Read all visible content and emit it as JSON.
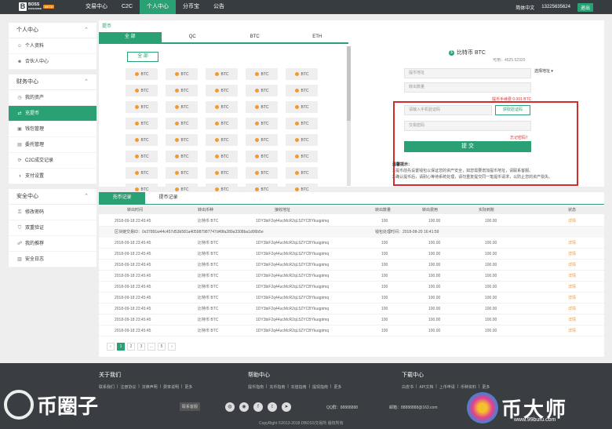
{
  "header": {
    "logo_mark": "B",
    "logo_text": "BOSS",
    "logo_sub": "EXCHANGE",
    "logo_badge": "BETA",
    "nav": [
      "交易中心",
      "C2C",
      "个人中心",
      "分币宝",
      "公告"
    ],
    "active_nav": "个人中心",
    "language": "简体中文",
    "phone": "13225635624",
    "logout": "退出"
  },
  "sidebar": {
    "groups": [
      {
        "title": "个人中心",
        "items": [
          "个人资料",
          "合伙人中心"
        ]
      },
      {
        "title": "财务中心",
        "items": [
          "我的资产",
          "充提币",
          "钱包管理",
          "委托管理",
          "C2C成交记录",
          "支付设置"
        ]
      },
      {
        "title": "安全中心",
        "items": [
          "修改密码",
          "双重验证",
          "我的推荐",
          "安全日志"
        ]
      }
    ],
    "active_item": "充提币",
    "icons": [
      "user-icon",
      "partner-icon",
      "asset-icon",
      "withdraw-icon",
      "wallet-icon",
      "order-icon",
      "c2c-icon",
      "pay-icon",
      "key-icon",
      "shield-icon",
      "referral-icon",
      "log-icon"
    ]
  },
  "withdraw": {
    "breadcrumb": "提币",
    "coin_tabs": [
      "全 部",
      "QC",
      "BTC",
      "ETH"
    ],
    "active_tab": "全 部",
    "all_button": "全 部",
    "coins": [
      "BTC",
      "BTC",
      "BTC",
      "BTC",
      "BTC",
      "BTC",
      "BTC",
      "BTC",
      "BTC",
      "BTC",
      "BTC",
      "BTC",
      "BTC",
      "BTC",
      "BTC",
      "BTC",
      "BTC",
      "BTC",
      "BTC",
      "BTC",
      "BTC",
      "BTC",
      "BTC",
      "BTC",
      "BTC",
      "BTC",
      "BTC",
      "BTC",
      "BTC",
      "BTC",
      "BTC",
      "BTC",
      "BTC",
      "BTC",
      "BTC",
      "BTC",
      "BTC",
      "BTC",
      "BTC",
      "BTC"
    ],
    "coin_title": "比特币 BTC",
    "available": "可用：4525.52320",
    "address_placeholder": "提币地址",
    "amount_placeholder": "转出数量",
    "select_address": "选择地址 ▾",
    "fee_note": "提币手续费 0.001 BTC",
    "sms_placeholder": "请输入手机验证码",
    "get_code": "获取验证码",
    "password_placeholder": "交易密码",
    "forgot": "忘记密码？",
    "submit": "提 交",
    "tips_title": "温馨提示：",
    "tips_1": "1.提币前先设置钱包以保证您的资产安全，如您需要增加提币地址，请联系客服。",
    "tips_2": "2.确认提币后，请耐心等待系统处理，请勿重复提交同一笔提币请求，以防止您的资产损失。"
  },
  "records": {
    "tabs": [
      "充币记录",
      "提币记录"
    ],
    "active_tab": "充币记录",
    "columns": [
      "转出时间",
      "转出币种",
      "接收地址",
      "转出数量",
      "转出费用",
      "实际到账",
      "状态"
    ],
    "expanded": {
      "label": "区块链交易ID：0x37891w44c457d53b581a405987987747d49fa289a3308ba1d06b5e",
      "time": "钱包处理时间：2018-08-20 16:41:59"
    },
    "rows": [
      [
        "2018-09-18 23:45:45",
        "比特币 BTC",
        "1DY3biF2q44ucMcR2qL5ZYCBYkuqptmq",
        "100",
        "100.00",
        "100.00",
        "详情"
      ],
      [
        "2018-09-18 23:45:45",
        "比特币 BTC",
        "1DY3biF2q44ucMcR2qL5ZYCBYkuqptmq",
        "100",
        "100.00",
        "100.00",
        "详情"
      ],
      [
        "2018-09-18 23:45:45",
        "比特币 BTC",
        "1DY3biF2q44ucMcR2qL5ZYCBYkuqptmq",
        "100",
        "100.00",
        "100.00",
        "详情"
      ],
      [
        "2018-09-18 23:45:45",
        "比特币 BTC",
        "1DY3biF2q44ucMcR2qL5ZYCBYkuqptmq",
        "100",
        "100.00",
        "100.00",
        "详情"
      ],
      [
        "2018-09-18 23:45:45",
        "比特币 BTC",
        "1DY3biF2q44ucMcR2qL5ZYCBYkuqptmq",
        "100",
        "100.00",
        "100.00",
        "详情"
      ],
      [
        "2018-09-18 23:45:45",
        "比特币 BTC",
        "1DY3biF2q44ucMcR2qL5ZYCBYkuqptmq",
        "100",
        "100.00",
        "100.00",
        "详情"
      ],
      [
        "2018-09-18 23:45:45",
        "比特币 BTC",
        "1DY3biF2q44ucMcR2qL5ZYCBYkuqptmq",
        "100",
        "100.00",
        "100.00",
        "详情"
      ],
      [
        "2018-09-18 23:45:45",
        "比特币 BTC",
        "1DY3biF2q44ucMcR2qL5ZYCBYkuqptmq",
        "100",
        "100.00",
        "100.00",
        "详情"
      ],
      [
        "2018-09-18 23:45:45",
        "比特币 BTC",
        "1DY3biF2q44ucMcR2qL5ZYCBYkuqptmq",
        "100",
        "100.00",
        "100.00",
        "详情"
      ],
      [
        "2018-09-18 23:45:45",
        "比特币 BTC",
        "1DY3biF2q44ucMcR2qL5ZYCBYkuqptmq",
        "100",
        "100.00",
        "100.00",
        "详情"
      ]
    ],
    "pager": [
      "‹",
      "1",
      "2",
      "3",
      "...",
      "5",
      "›"
    ],
    "active_page": "1"
  },
  "footer": {
    "about_title": "关于我们",
    "about_links": [
      "联系我们",
      "|",
      "注册协议",
      "|",
      "法律声明",
      "|",
      "费率说明",
      "|",
      "更多"
    ],
    "help_title": "帮助中心",
    "help_links": [
      "提币指南",
      "|",
      "充币指南",
      "|",
      "充值指南",
      "|",
      "提现指南",
      "|",
      "更多"
    ],
    "download_title": "下载中心",
    "download_links": [
      "白皮书",
      "|",
      "API文档",
      "|",
      "上币申请",
      "|",
      "币种资料",
      "|",
      "更多"
    ],
    "contact": "联系客服",
    "social": [
      "wechat-icon",
      "qq-icon",
      "facebook-icon",
      "twitter-icon",
      "telegram-icon"
    ],
    "social_glyphs": [
      "◍",
      "◉",
      "f",
      "t",
      "➤"
    ],
    "qq": "QQ群：88888888",
    "mail": "邮箱：88888888@163.com",
    "copyright": "CopyRight ©2013-2018 DBOSS交易所 版权所有"
  },
  "watermarks": {
    "left": "币圈子",
    "right": "币大师",
    "url": "www.99bufu.com"
  },
  "colors": {
    "accent": "#2aa174",
    "highlight": "#d52b2b",
    "coin": "#f29a2e",
    "dark": "#373c41"
  }
}
